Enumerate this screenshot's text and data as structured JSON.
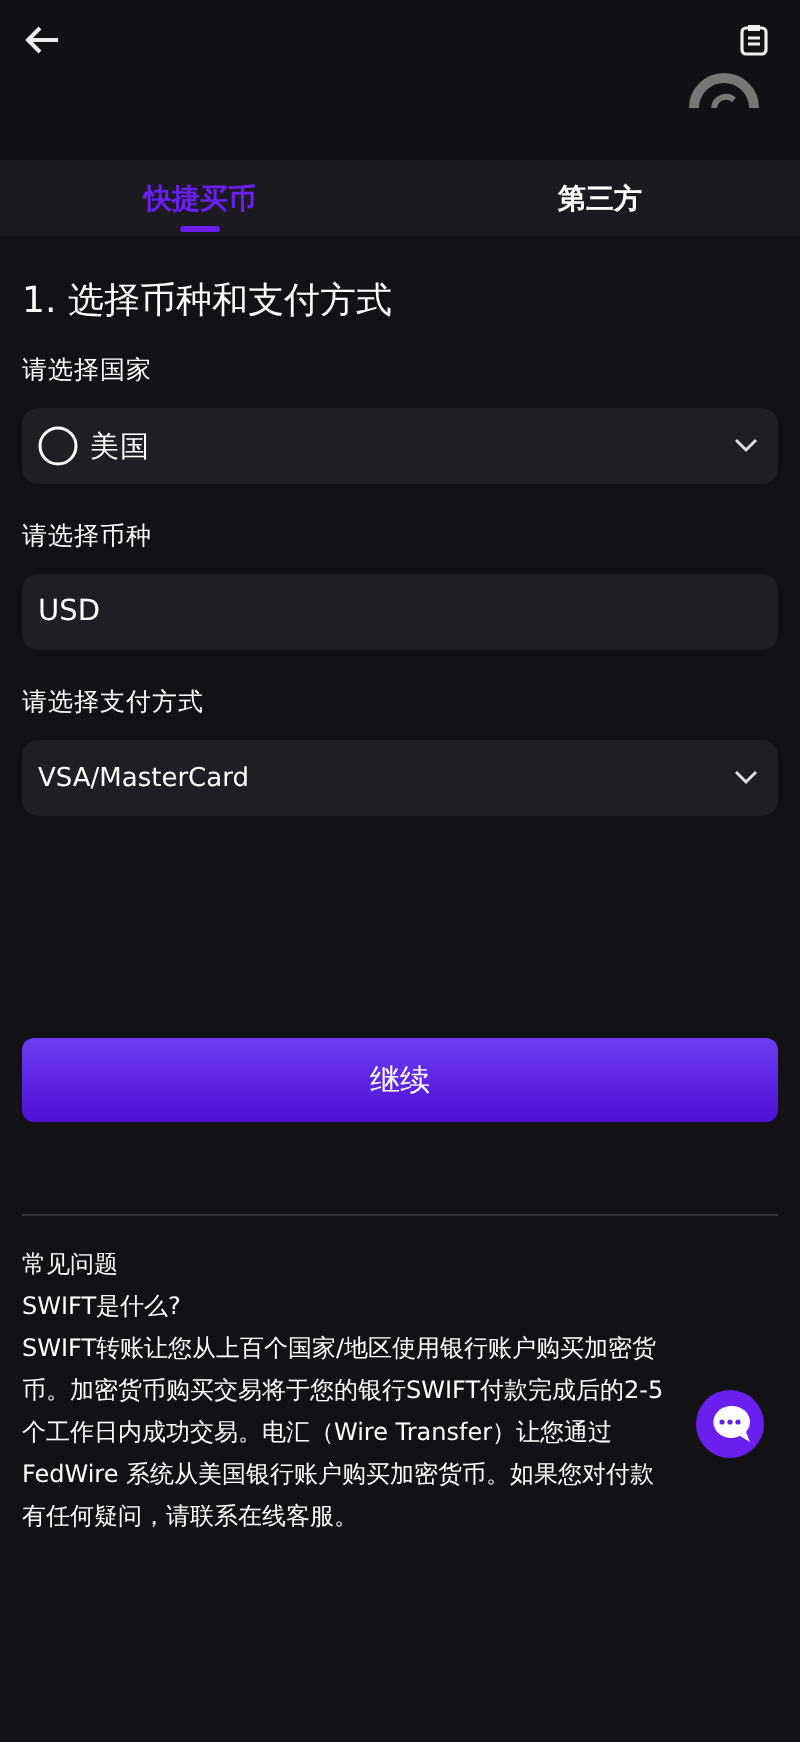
{
  "tabs": [
    {
      "label": "快捷买币",
      "selected": true
    },
    {
      "label": "第三方",
      "selected": false
    }
  ],
  "section_title": "1. 选择币种和支付方式",
  "fields": [
    {
      "label": "请选择国家",
      "kind": "select",
      "value": "美国",
      "flag": true
    },
    {
      "label": "请选择币种",
      "kind": "text",
      "value": "USD"
    },
    {
      "label": "请选择支付方式",
      "kind": "select",
      "value": "VSA/MasterCard"
    }
  ],
  "continue_button": "继续",
  "faq": {
    "title": "常见问题",
    "question": "SWIFT是什么?",
    "answer": "SWIFT转账让您从上百个国家/地区使用银行账户购买加密货币。加密货币购买交易将于您的银行SWIFT付款完成后的2-5个工作日内成功交易。电汇（Wire Transfer）让您通过FedWire 系统从美国银行账户购买加密货币。如果您对付款有任何疑问，请联系在线客服。"
  }
}
